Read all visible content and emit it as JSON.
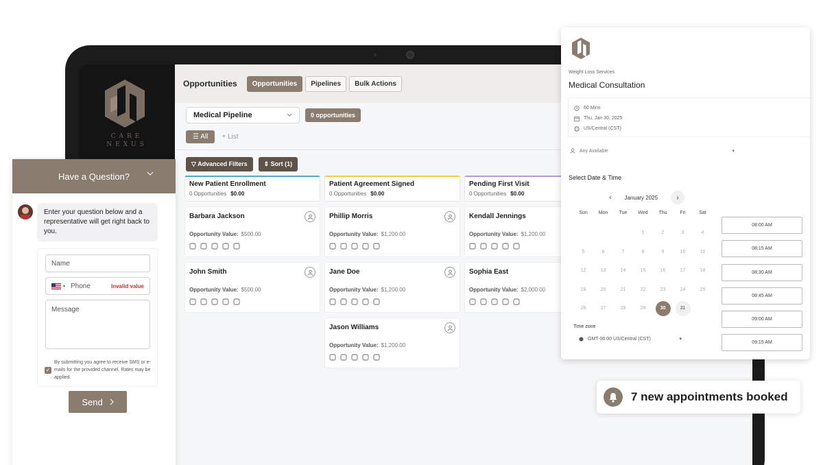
{
  "colors": {
    "brand": "#8b7c70",
    "brand_dark": "#5e5249",
    "error": "#c0392b"
  },
  "brand": {
    "line1": "CARE",
    "line2": "NEXUS"
  },
  "crm": {
    "title": "Opportunities",
    "tabs": [
      "Opportunities",
      "Pipelines",
      "Bulk Actions"
    ],
    "pipeline": "Medical Pipeline",
    "count": "0 opportunities",
    "views": {
      "all": "All",
      "list": "List"
    },
    "actions": {
      "filters": "Advanced Filters",
      "sort": "Sort (1)"
    },
    "columns": [
      {
        "title": "New Patient Enrollment",
        "sub": "0 Opportunities",
        "amount": "$0.00",
        "accent": "#4ea8de",
        "cards": [
          {
            "name": "Barbara Jackson",
            "value": "$500.00"
          },
          {
            "name": "John Smith",
            "value": "$500.00"
          }
        ]
      },
      {
        "title": "Patient Agreement Signed",
        "sub": "0 Opportunities",
        "amount": "$0.00",
        "accent": "#f2c94c",
        "cards": [
          {
            "name": "Phillip Morris",
            "value": "$1,200.00"
          },
          {
            "name": "Jane Doe",
            "value": "$1,200.00"
          },
          {
            "name": "Jason Williams",
            "value": "$1,200.00"
          }
        ]
      },
      {
        "title": "Pending First Visit",
        "sub": "0 Opportunities",
        "amount": "$0.00",
        "accent": "#b39ddb",
        "cards": [
          {
            "name": "Kendall Jennings",
            "value": "$1,200.00"
          },
          {
            "name": "Sophia East",
            "value": "$2,000.00"
          }
        ]
      }
    ],
    "value_label": "Opportunity Value:"
  },
  "chat": {
    "header": "Have a Question?",
    "message": "Enter your question below and a representative will get right back to you.",
    "name_placeholder": "Name",
    "phone_placeholder": "Phone",
    "phone_error": "Invalid value",
    "message_placeholder": "Message",
    "consent": "By submitting you agree to receive SMS or e-mails for the provided channel. Rates may be applied.",
    "send": "Send"
  },
  "booking": {
    "service": "Weight Loss Services",
    "title": "Medical Consultation",
    "duration": "60 Mins",
    "date": "Thu, Jan 30, 2025",
    "timezone_short": "US/Central (CST)",
    "staff": "Any Available",
    "select_label": "Select Date & Time",
    "month": "January 2025",
    "weekdays": [
      "Sun",
      "Mon",
      "Tue",
      "Wed",
      "Thu",
      "Fri",
      "Sat"
    ],
    "selected_day": "30",
    "timezone_label": "Time zone",
    "timezone": "GMT-06:00 US/Central (CST)",
    "slots": [
      "08:00 AM",
      "08:15 AM",
      "08:30 AM",
      "08:45 AM",
      "09:00 AM",
      "09:15 AM"
    ]
  },
  "notification": {
    "text": "7 new appointments booked"
  }
}
